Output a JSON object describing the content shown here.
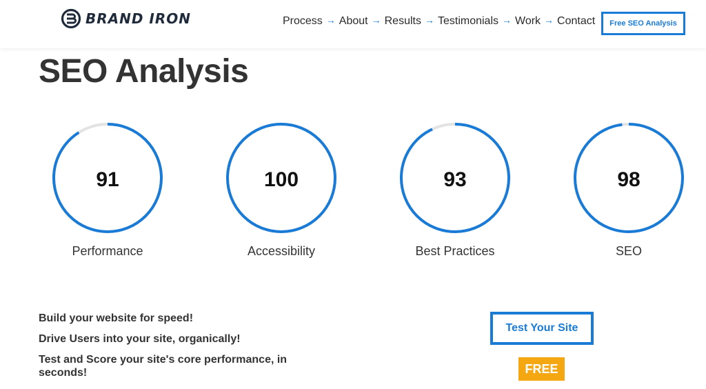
{
  "header": {
    "brand": "BRAND IRON",
    "nav": [
      "Process",
      "About",
      "Results",
      "Testimonials",
      "Work",
      "Contact"
    ],
    "nav_arrow": "→",
    "cta_label": "Free SEO Analysis"
  },
  "page": {
    "title": "SEO Analysis"
  },
  "gauges": [
    {
      "score": "91",
      "label": "Performance",
      "value": 91
    },
    {
      "score": "100",
      "label": "Accessibility",
      "value": 100
    },
    {
      "score": "93",
      "label": "Best Practices",
      "value": 93
    },
    {
      "score": "98",
      "label": "SEO",
      "value": 98
    }
  ],
  "bullets": [
    "Build your website for speed!",
    "Drive Users into your site, organically!",
    "Test and Score your site's core performance, in seconds!"
  ],
  "actions": {
    "test_label": "Test Your Site",
    "free_label": "FREE"
  },
  "colors": {
    "accent": "#1a7bd6",
    "track": "#e3e3e3",
    "badge": "#f5a712",
    "brand_dark": "#1f2a3a"
  }
}
